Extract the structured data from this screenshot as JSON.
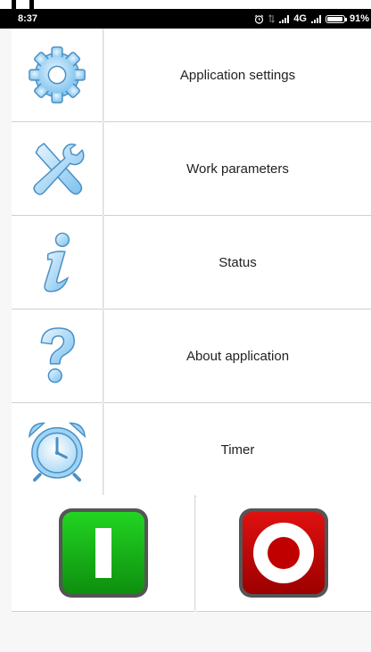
{
  "status_bar": {
    "time": "8:37",
    "network": "4G",
    "battery": "91%"
  },
  "menu": {
    "items": [
      {
        "label": "Application settings",
        "icon": "gear-icon"
      },
      {
        "label": "Work parameters",
        "icon": "tools-icon"
      },
      {
        "label": "Status",
        "icon": "info-icon"
      },
      {
        "label": "About application",
        "icon": "question-icon"
      },
      {
        "label": "Timer",
        "icon": "alarm-clock-icon"
      }
    ]
  },
  "controls": {
    "start": {
      "icon": "power-on-icon",
      "color": "#1db31d"
    },
    "stop": {
      "icon": "power-off-icon",
      "color": "#d10000"
    }
  },
  "colors": {
    "icon_fill": "#9dd3f5",
    "icon_stroke": "#4a8fc4"
  }
}
